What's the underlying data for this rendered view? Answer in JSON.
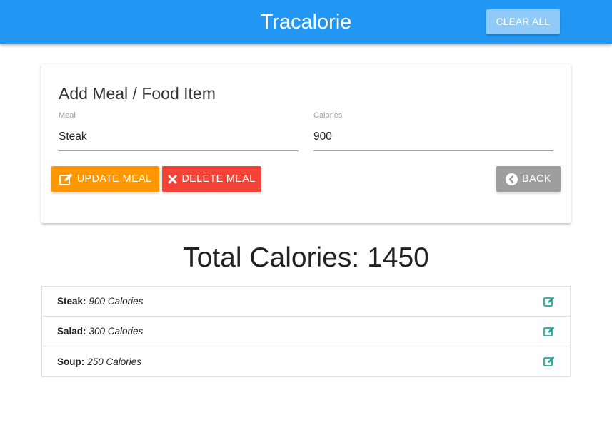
{
  "app": {
    "brand": "Tracalorie",
    "clear_all_label": "CLEAR ALL"
  },
  "form": {
    "title": "Add Meal / Food Item",
    "meal_label": "Meal",
    "meal_value": "Steak",
    "calories_label": "Calories",
    "calories_value": "900",
    "update_label": "UPDATE MEAL",
    "delete_label": "DELETE MEAL",
    "back_label": "BACK"
  },
  "total": {
    "text": "Total Calories: 1450"
  },
  "items": [
    {
      "name": "Steak:",
      "calories": "900 Calories"
    },
    {
      "name": "Salad:",
      "calories": "300 Calories"
    },
    {
      "name": "Soup:",
      "calories": "250 Calories"
    }
  ],
  "icons": {
    "update": "edit-icon",
    "delete": "close-icon",
    "back": "chevron-left-circle-icon",
    "item_edit": "edit-icon"
  },
  "colors": {
    "navbar": "#2196f3",
    "clear_button": "#90caf9",
    "update_button": "#ff9800",
    "delete_button": "#f44336",
    "back_button": "#9e9e9e",
    "edit_icon": "#26a69a"
  }
}
